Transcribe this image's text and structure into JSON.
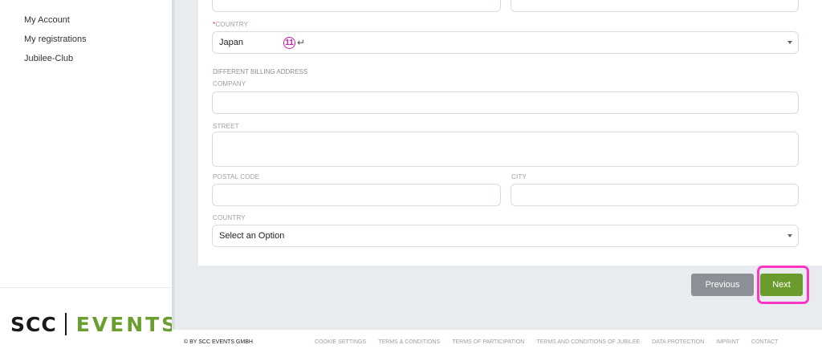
{
  "sidebar": {
    "items": [
      {
        "label": "My Account"
      },
      {
        "label": "My registrations"
      },
      {
        "label": "Jubilee-Club"
      }
    ]
  },
  "logo": {
    "left": "SCC",
    "right": "EVENTS"
  },
  "form": {
    "country": {
      "label": "COUNTRY",
      "required_mark": "*",
      "value": "Japan"
    },
    "annotation": {
      "number": "11",
      "symbol": "↵"
    },
    "billing_heading": "DIFFERENT BILLING ADDRESS",
    "company": {
      "label": "COMPANY",
      "value": ""
    },
    "street": {
      "label": "STREET",
      "value": ""
    },
    "postal_code": {
      "label": "POSTAL CODE",
      "value": ""
    },
    "city": {
      "label": "CITY",
      "value": ""
    },
    "billing_country": {
      "label": "COUNTRY",
      "placeholder": "Select an Option"
    }
  },
  "buttons": {
    "previous": "Previous",
    "next": "Next"
  },
  "footer": {
    "copyright": "© BY SCC EVENTS GMBH",
    "links": [
      "COOKIE SETTINGS",
      "TERMS & CONDITIONS",
      "TERMS OF PARTICIPATION",
      "TERMS AND CONDITIONS OF JUBILEE",
      "DATA PROTECTION",
      "IMPRINT",
      "CONTACT"
    ]
  },
  "colors": {
    "accent": "#6b9a2d",
    "highlight": "#ff35c8",
    "required": "#e0245e"
  }
}
